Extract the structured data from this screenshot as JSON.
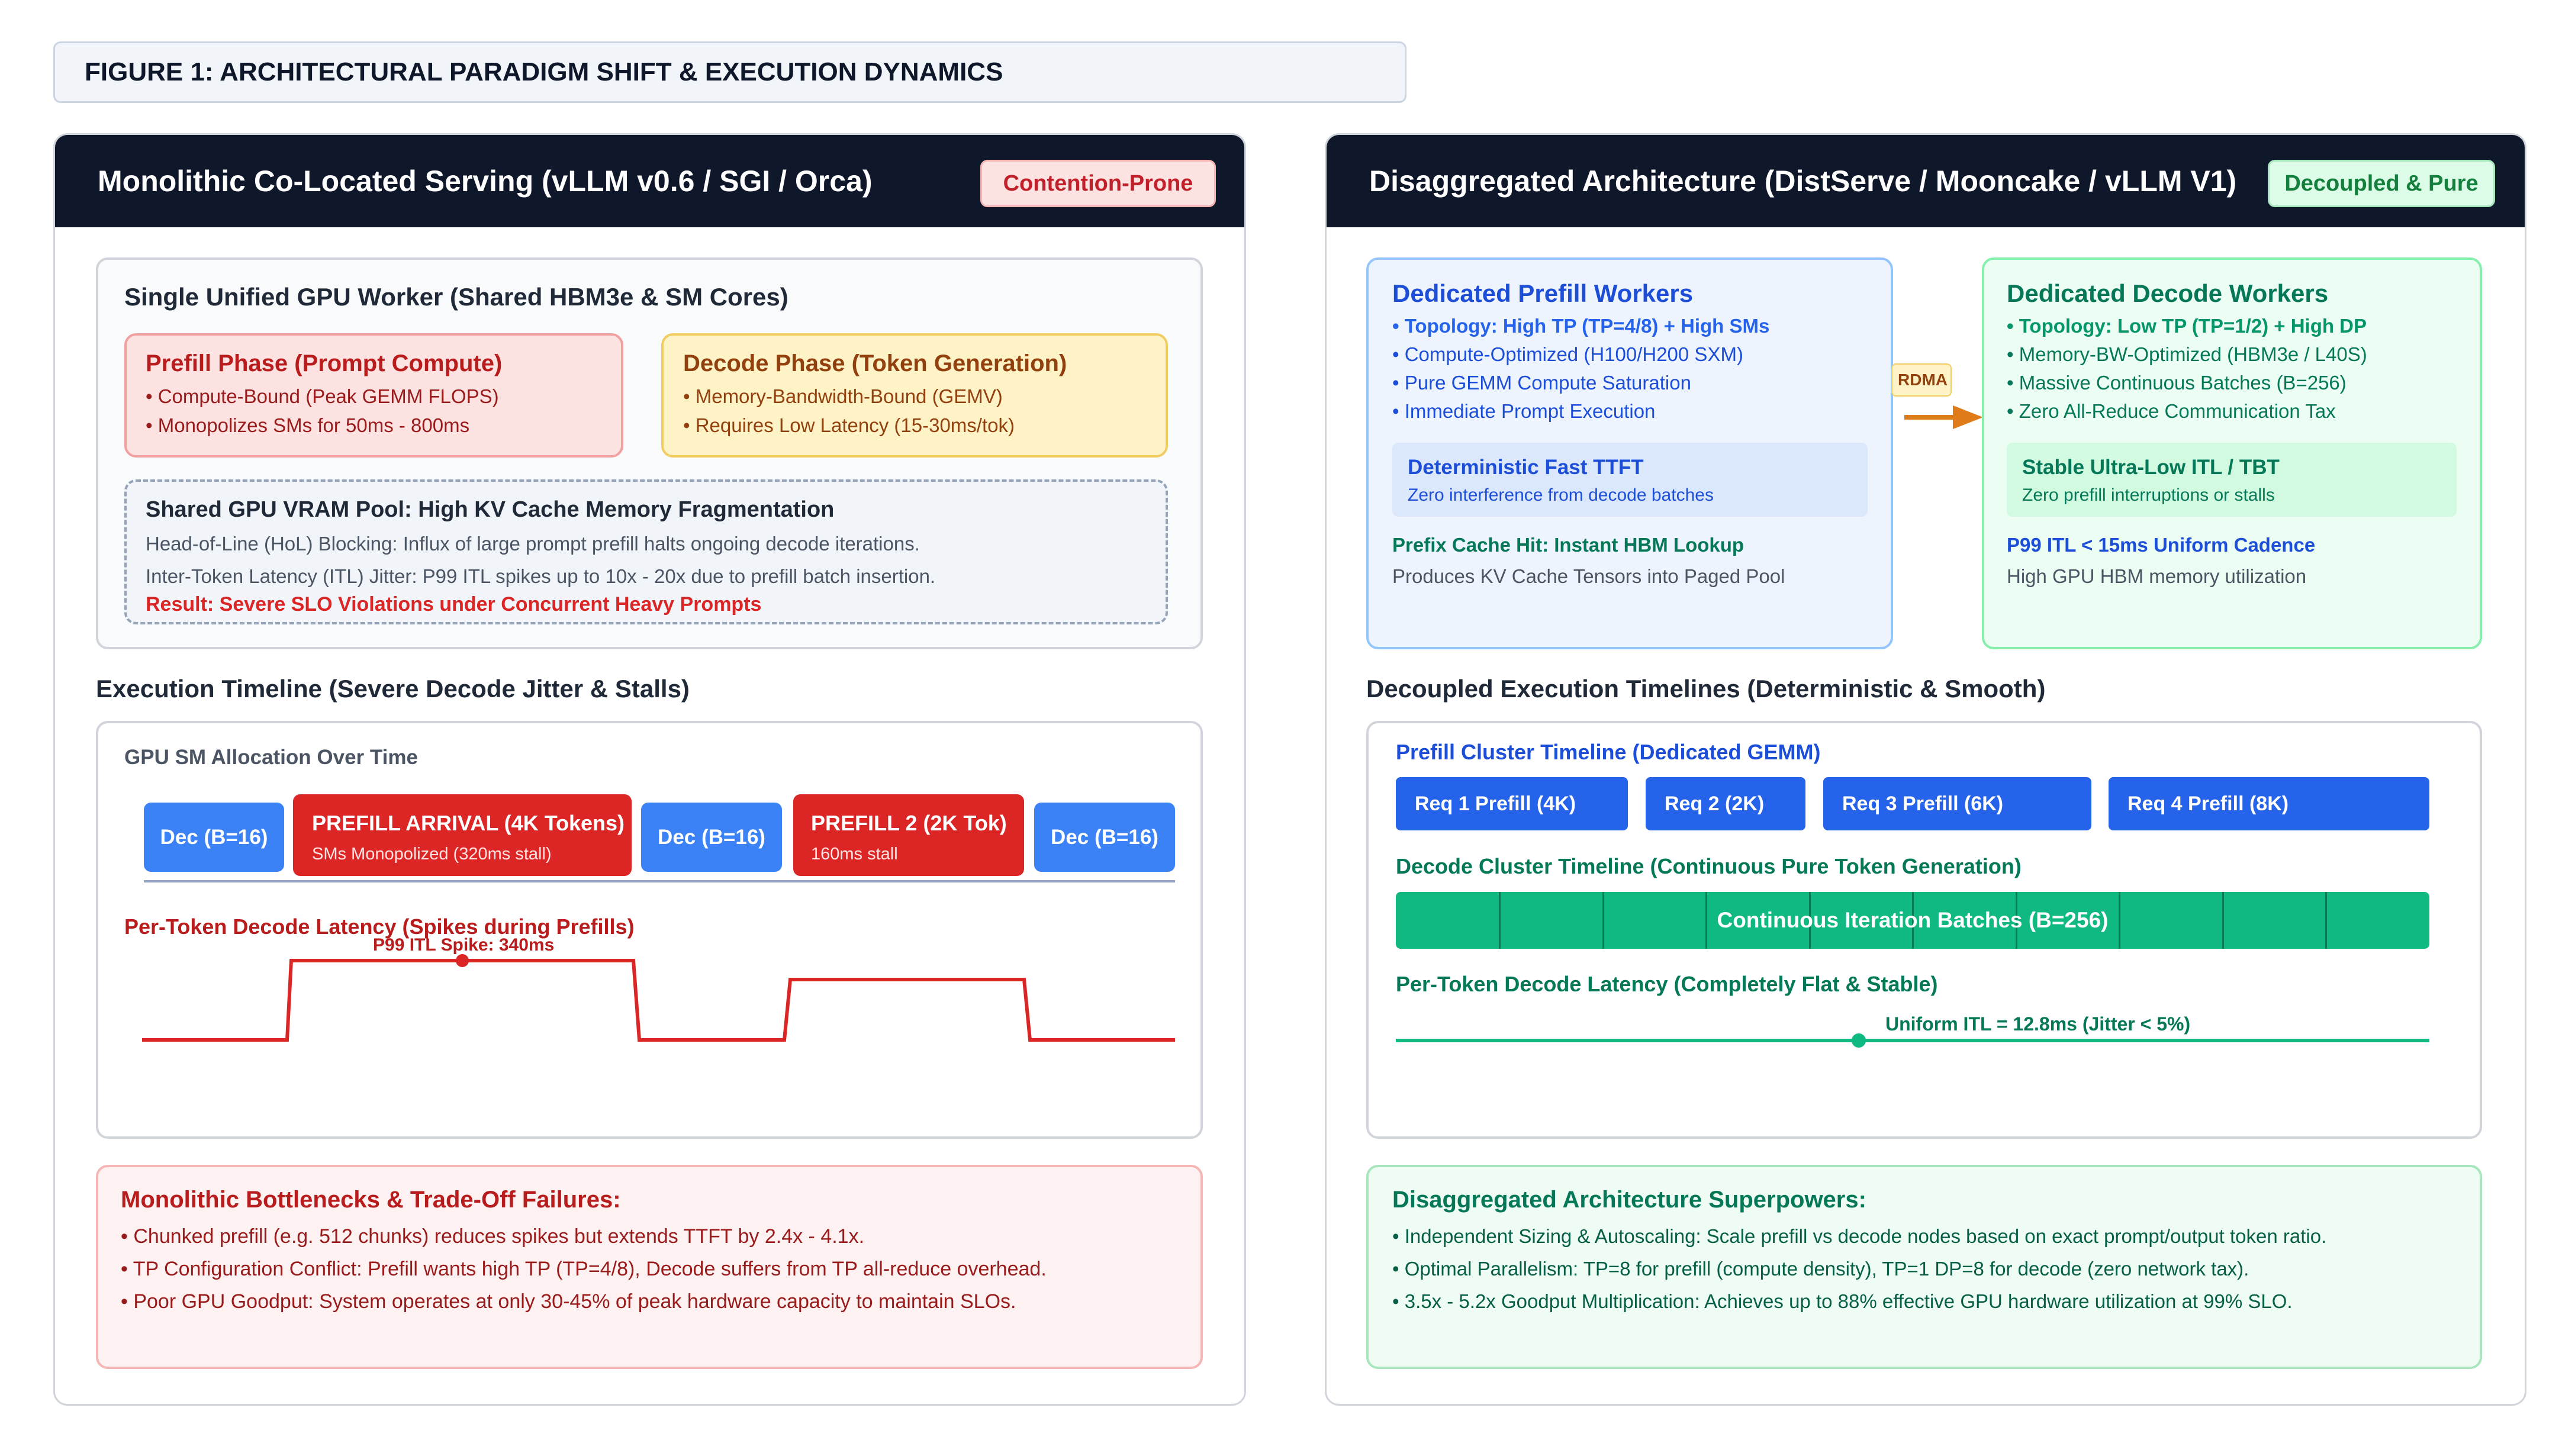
{
  "figure_title": "FIGURE 1: ARCHITECTURAL PARADIGM SHIFT & EXECUTION DYNAMICS",
  "colors": {
    "navy": "#0f172a",
    "red": "#dc2626",
    "blue": "#2563eb",
    "green": "#10b981",
    "orange": "#e07b1a"
  },
  "left": {
    "title": "Monolithic Co-Located Serving (vLLM v0.6 / SGI / Orca)",
    "badge": "Contention-Prone",
    "worker": {
      "title": "Single Unified GPU Worker (Shared HBM3e & SM Cores)",
      "prefill": {
        "title": "Prefill Phase (Prompt Compute)",
        "bullets": [
          "• Compute-Bound (Peak GEMM FLOPS)",
          "• Monopolizes SMs for 50ms - 800ms"
        ]
      },
      "decode": {
        "title": "Decode Phase (Token Generation)",
        "bullets": [
          "• Memory-Bandwidth-Bound (GEMV)",
          "• Requires Low Latency (15-30ms/tok)"
        ]
      },
      "pool": {
        "title": "Shared GPU VRAM Pool: High KV Cache Memory Fragmentation",
        "lines": [
          "Head-of-Line (HoL) Blocking: Influx of large prompt prefill halts ongoing decode iterations.",
          "Inter-Token Latency (ITL) Jitter: P99 ITL spikes up to 10x - 20x due to prefill batch insertion."
        ],
        "result": "Result: Severe SLO Violations under Concurrent Heavy Prompts"
      }
    },
    "timeline": {
      "section_title": "Execution Timeline (Severe Decode Jitter & Stalls)",
      "alloc_label": "GPU SM Allocation Over Time",
      "blocks": [
        {
          "title": "Dec (B=16)",
          "sub": ""
        },
        {
          "title": "PREFILL ARRIVAL (4K Tokens)",
          "sub": "SMs Monopolized (320ms stall)"
        },
        {
          "title": "Dec (B=16)",
          "sub": ""
        },
        {
          "title": "PREFILL 2 (2K Tok)",
          "sub": "160ms stall"
        },
        {
          "title": "Dec (B=16)",
          "sub": ""
        }
      ],
      "latency_label": "Per-Token Decode Latency (Spikes during Prefills)",
      "spike_label": "P99 ITL Spike: 340ms"
    },
    "bottlenecks": {
      "title": "Monolithic Bottlenecks & Trade-Off Failures:",
      "bullets": [
        "• Chunked prefill (e.g. 512 chunks) reduces spikes but extends TTFT by 2.4x - 4.1x.",
        "• TP Configuration Conflict: Prefill wants high TP (TP=4/8), Decode suffers from TP all-reduce overhead.",
        "• Poor GPU Goodput: System operates at only 30-45% of peak hardware capacity to maintain SLOs."
      ]
    }
  },
  "right": {
    "title": "Disaggregated Architecture (DistServe / Mooncake / vLLM V1)",
    "badge": "Decoupled & Pure",
    "prefill_workers": {
      "title": "Dedicated Prefill Workers",
      "topology": "• Topology: High TP (TP=4/8) + High SMs",
      "bullets": [
        "• Compute-Optimized (H100/H200 SXM)",
        "• Pure GEMM Compute Saturation",
        "• Immediate Prompt Execution"
      ],
      "highlight_title": "Deterministic Fast TTFT",
      "highlight_sub": "Zero interference from decode batches",
      "foot_title": "Prefix Cache Hit: Instant HBM Lookup",
      "foot_sub": "Produces KV Cache Tensors into Paged Pool"
    },
    "rdma_label": "RDMA",
    "decode_workers": {
      "title": "Dedicated Decode Workers",
      "topology": "• Topology: Low TP (TP=1/2) + High DP",
      "bullets": [
        "• Memory-BW-Optimized (HBM3e / L40S)",
        "• Massive Continuous Batches (B=256)",
        "• Zero All-Reduce Communication Tax"
      ],
      "highlight_title": "Stable Ultra-Low ITL / TBT",
      "highlight_sub": "Zero prefill interruptions or stalls",
      "foot_title": "P99 ITL < 15ms Uniform Cadence",
      "foot_sub": "High GPU HBM memory utilization"
    },
    "timeline": {
      "section_title": "Decoupled Execution Timelines (Deterministic & Smooth)",
      "prefill_label": "Prefill Cluster Timeline (Dedicated GEMM)",
      "prefill_blocks": [
        "Req 1 Prefill (4K)",
        "Req 2 (2K)",
        "Req 3 Prefill (6K)",
        "Req 4 Prefill (8K)"
      ],
      "decode_label": "Decode Cluster Timeline (Continuous Pure Token Generation)",
      "decode_bar": "Continuous Iteration Batches (B=256)",
      "latency_label": "Per-Token Decode Latency (Completely Flat & Stable)",
      "itl_label": "Uniform ITL = 12.8ms (Jitter < 5%)"
    },
    "superpowers": {
      "title": "Disaggregated Architecture Superpowers:",
      "bullets": [
        "• Independent Sizing & Autoscaling: Scale prefill vs decode nodes based on exact prompt/output token ratio.",
        "• Optimal Parallelism: TP=8 for prefill (compute density), TP=1 DP=8 for decode (zero network tax).",
        "• 3.5x - 5.2x Goodput Multiplication: Achieves up to 88% effective GPU hardware utilization at 99% SLO."
      ]
    }
  }
}
